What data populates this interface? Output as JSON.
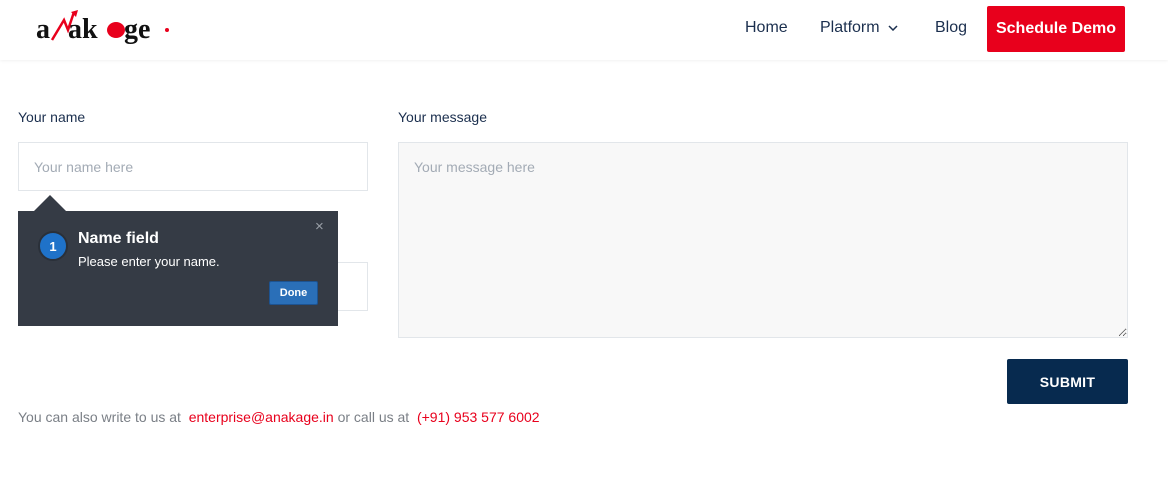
{
  "header": {
    "logo_text": "anakage",
    "nav": {
      "home": "Home",
      "platform": "Platform",
      "blog": "Blog"
    },
    "demo_label": "Schedule Demo"
  },
  "form": {
    "name_label": "Your name",
    "name_placeholder": "Your name here",
    "message_label": "Your message",
    "message_placeholder": "Your message here",
    "submit_label": "SUBMIT"
  },
  "contact": {
    "prefix": "You can also write to us at",
    "email": "enterprise@anakage.in",
    "middle": "or call us at",
    "phone": "(+91) 953 577 6002"
  },
  "tour": {
    "step": "1",
    "title": "Name field",
    "text": "Please enter your name.",
    "close": "×",
    "done_label": "Done"
  },
  "colors": {
    "brand_red": "#e8001c",
    "navy": "#072a4f",
    "tooltip_bg": "#353b45",
    "step_blue": "#1f72c9"
  }
}
